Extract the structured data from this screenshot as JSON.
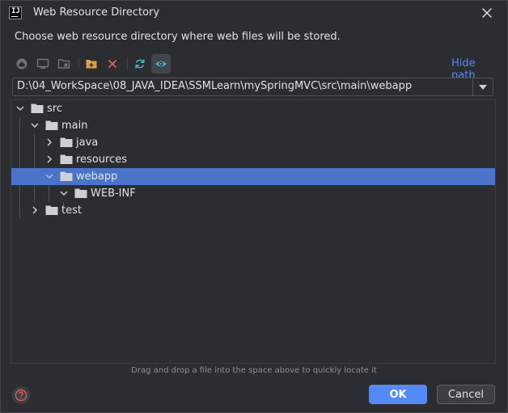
{
  "window": {
    "title": "Web Resource Directory",
    "logo_text": "IJ",
    "description": "Choose web resource directory where web files will be stored."
  },
  "toolbar": {
    "buttons": [
      {
        "name": "home-icon"
      },
      {
        "name": "desktop-icon"
      },
      {
        "name": "project-icon"
      },
      {
        "name": "new-folder-icon"
      },
      {
        "name": "delete-icon"
      },
      {
        "name": "refresh-icon"
      },
      {
        "name": "show-hidden-icon"
      }
    ],
    "hide_path_label": "Hide path"
  },
  "path": {
    "value": "D:\\04_WorkSpace\\08_JAVA_IDEA\\SSMLearn\\mySpringMVC\\src\\main\\webapp"
  },
  "tree": {
    "nodes": [
      {
        "label": "src",
        "depth": 0,
        "expanded": true,
        "selected": false
      },
      {
        "label": "main",
        "depth": 1,
        "expanded": true,
        "selected": false
      },
      {
        "label": "java",
        "depth": 2,
        "expanded": false,
        "selected": false
      },
      {
        "label": "resources",
        "depth": 2,
        "expanded": false,
        "selected": false
      },
      {
        "label": "webapp",
        "depth": 2,
        "expanded": true,
        "selected": true
      },
      {
        "label": "WEB-INF",
        "depth": 3,
        "expanded": true,
        "selected": false
      },
      {
        "label": "test",
        "depth": 1,
        "expanded": false,
        "selected": false
      }
    ]
  },
  "drop_hint": "Drag and drop a file into the space above to quickly locate it",
  "buttons": {
    "ok": "OK",
    "cancel": "Cancel"
  },
  "colors": {
    "background": "#2b2d30",
    "accent": "#548af7",
    "selection": "#4a74c9",
    "folder": "#ced0d6",
    "delete": "#db5c5c",
    "refresh": "#3fb6c9",
    "help": "#db5c5c"
  }
}
